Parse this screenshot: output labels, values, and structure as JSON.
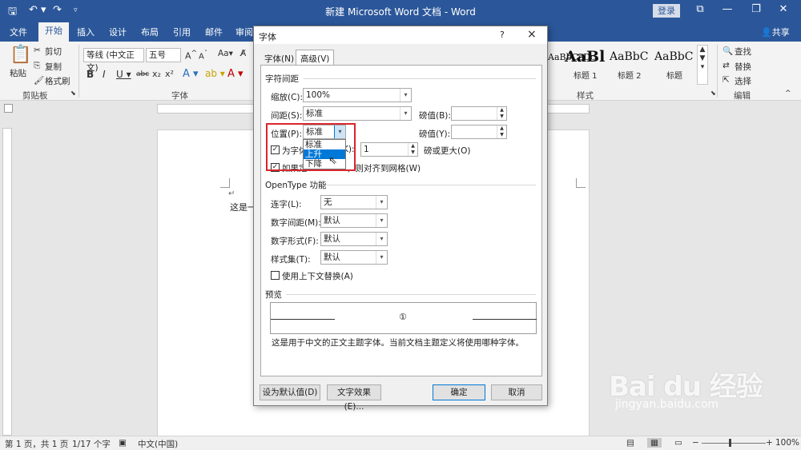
{
  "app": {
    "window_title": "新建 Microsoft Word 文档 - Word",
    "login_label": "登录",
    "share_label": "共享"
  },
  "menu": {
    "tabs": [
      "文件",
      "开始",
      "插入",
      "设计",
      "布局",
      "引用",
      "邮件",
      "审阅"
    ]
  },
  "ribbon": {
    "clipboard": {
      "paste": "粘贴",
      "cut": "剪切",
      "copy": "复制",
      "format_painter": "格式刷",
      "group_label": "剪贴板"
    },
    "font": {
      "font_name": "等线 (中文正文)",
      "font_size": "五号",
      "group_label": "字体"
    },
    "styles": {
      "samples": [
        "AaBbCcDc",
        "AaBl",
        "AaBbC",
        "AaBbC"
      ],
      "labels": [
        "",
        "标题 1",
        "标题 2",
        "标题"
      ],
      "group_label": "样式"
    },
    "editing": {
      "find": "查找",
      "replace": "替换",
      "select": "选择",
      "group_label": "编辑"
    }
  },
  "document": {
    "text": "这是一",
    "paragraph_mark": "↵"
  },
  "statusbar": {
    "page": "第 1 页，共 1 页",
    "words": "1/17 个字",
    "language": "中文(中国)",
    "zoom": "100%"
  },
  "dialog": {
    "title": "字体",
    "help": "?",
    "close": "×",
    "tabs": {
      "font": "字体(N)",
      "advanced": "高级(V)"
    },
    "char_spacing": {
      "section": "字符间距",
      "scale_label": "缩放(C):",
      "scale_value": "100%",
      "spacing_label": "间距(S):",
      "spacing_value": "标准",
      "spacing_pt_label": "磅值(B):",
      "position_label": "位置(P):",
      "position_value": "标准",
      "position_pt_label": "磅值(Y):",
      "position_options": [
        "标准",
        "上升",
        "下降"
      ],
      "kerning_label": "为字体",
      "kerning_key": "K):",
      "kerning_value": "1",
      "kerning_suffix": "磅或更大(O)",
      "grid_label": "如果定",
      "grid_suffix": "，则对齐到网格(W)"
    },
    "opentype": {
      "section": "OpenType 功能",
      "ligatures_label": "连字(L):",
      "ligatures_value": "无",
      "num_spacing_label": "数字间距(M):",
      "num_spacing_value": "默认",
      "num_form_label": "数字形式(F):",
      "num_form_value": "默认",
      "stylistic_label": "样式集(T):",
      "stylistic_value": "默认",
      "contextual_label": "使用上下文替换(A)"
    },
    "preview": {
      "section": "预览",
      "symbol": "①",
      "description": "这是用于中文的正文主题字体。当前文档主题定义将使用哪种字体。"
    },
    "buttons": {
      "set_default": "设为默认值(D)",
      "text_effects": "文字效果(E)...",
      "ok": "确定",
      "cancel": "取消"
    }
  },
  "watermark": {
    "main": "Bai du 经验",
    "sub": "jingyan.baidu.com"
  },
  "colors": {
    "word_blue": "#2b579a",
    "highlight_red": "#d9262b",
    "selection_blue": "#0078d7"
  }
}
